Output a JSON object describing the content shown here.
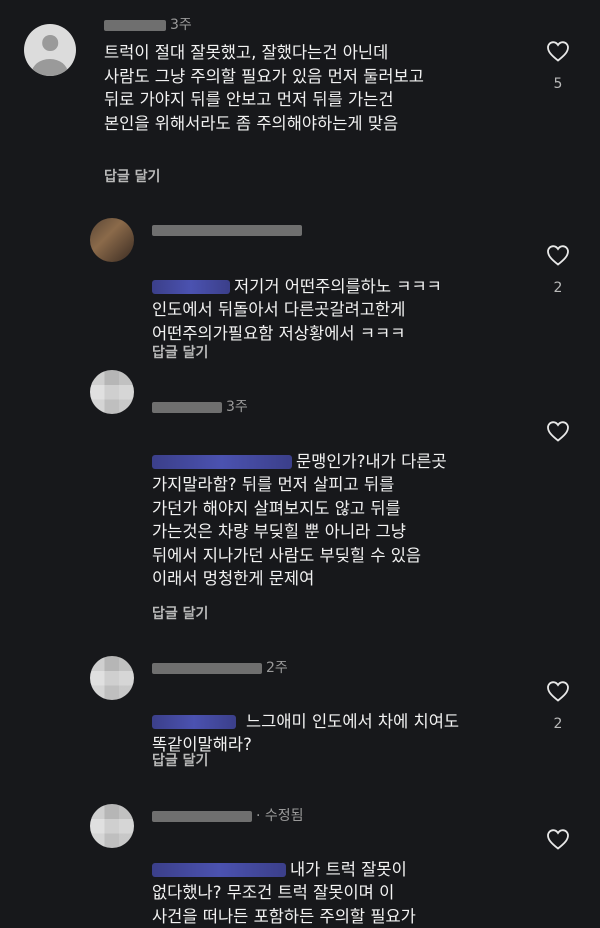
{
  "comments": [
    {
      "time": "3주",
      "text": "트럭이 절대 잘못했고, 잘했다는건 아닌데\n사람도 그냥 주의할 필요가 있음 먼저 둘러보고\n뒤로 가야지 뒤를 안보고 먼저 뒤를 가는건\n본인을 위해서라도 좀 주의해야하는게 맞음",
      "reply_label": "답글 달기",
      "likes": "5"
    },
    {
      "time": "",
      "text": "저기거 어떤주의를하노 ㅋㅋㅋ\n인도에서 뒤돌아서 다른곳갈려고한게\n어떤주의가필요함 저상황에서 ㅋㅋㅋ",
      "reply_label": "답글 달기",
      "likes": "2"
    },
    {
      "time": "3주",
      "text": "문맹인가?내가 다른곳\n가지말라함? 뒤를 먼저 살피고 뒤를\n가던가 해야지 살펴보지도 않고 뒤를\n가는것은 차량 부딪힐 뿐 아니라 그냥\n뒤에서 지나가던 사람도 부딪힐 수 있음\n이래서 멍청한게 문제여",
      "reply_label": "답글 달기",
      "likes": ""
    },
    {
      "time": "2주",
      "text": "느그애미 인도에서 차에 치여도\n똑같이말해라?",
      "reply_label": "답글 달기",
      "likes": "2"
    },
    {
      "time": "· 수정됨",
      "text": "내가 트럭 잘못이\n없다했나? 무조건 트럭 잘못이며 이\n사건을 떠나든 포함하든 주의할 필요가",
      "reply_label": "",
      "likes": ""
    }
  ],
  "icons": {
    "like": "heart-outline-icon"
  },
  "colors": {
    "background": "#17181b",
    "text": "#f2f2f2",
    "muted": "#9a9a9a",
    "mention": "#4b52b0"
  }
}
